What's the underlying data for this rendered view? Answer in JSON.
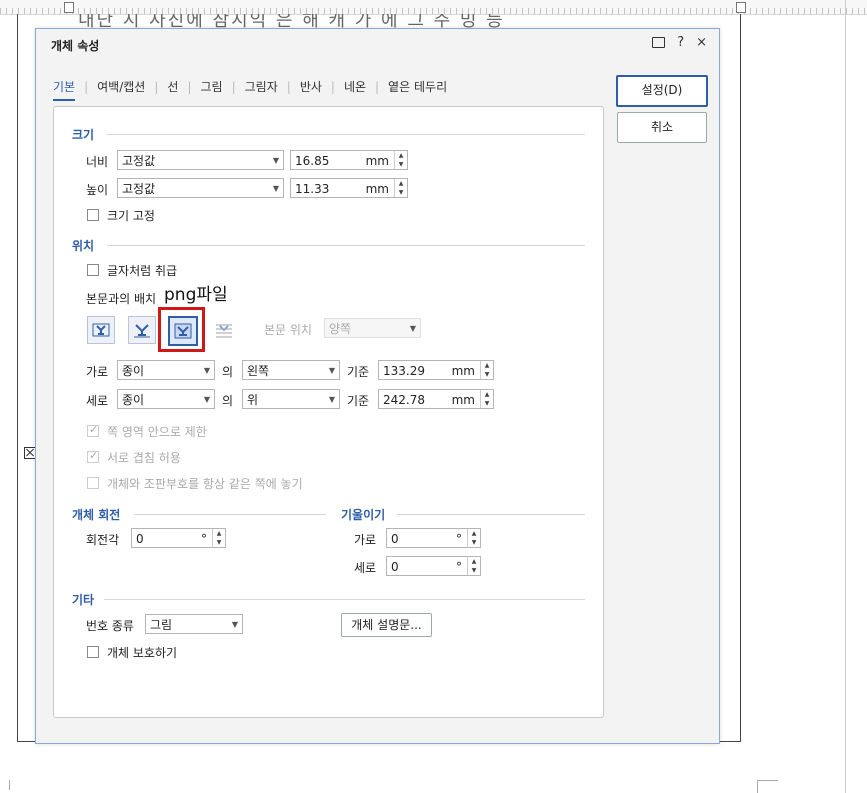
{
  "background": {
    "partial_text": "내단 시 사진에 참시익 은 해 캐 가 에 그 주 밍 등"
  },
  "dialog": {
    "title": "개체 속성",
    "title_icons": [
      "comment-icon",
      "help-icon",
      "close-icon"
    ],
    "help_glyph": "?",
    "close_glyph": "×",
    "tabs": [
      "기본",
      "여백/캡션",
      "선",
      "그림",
      "그림자",
      "반사",
      "네온",
      "옅은 테두리"
    ],
    "buttons": {
      "ok": "설정(D)",
      "cancel": "취소"
    },
    "size": {
      "title": "크기",
      "width_label": "너비",
      "width_mode": "고정값",
      "width_value": "16.85",
      "width_unit": "mm",
      "height_label": "높이",
      "height_mode": "고정값",
      "height_value": "11.33",
      "height_unit": "mm",
      "lock_label": "크기 고정"
    },
    "position": {
      "title": "위치",
      "treat_as_char": "글자처럼 취급",
      "wrap_label": "본문과의 배치",
      "body_pos_label": "본문 위치",
      "body_pos_value": "양쪽",
      "horiz_label": "가로",
      "horiz_ref": "종이",
      "of1": "의",
      "horiz_align": "왼쪽",
      "base1": "기준",
      "horiz_value": "133.29",
      "horiz_unit": "mm",
      "vert_label": "세로",
      "vert_ref": "종이",
      "of2": "의",
      "vert_align": "위",
      "base2": "기준",
      "vert_value": "242.78",
      "vert_unit": "mm",
      "limit_page": "쪽 영역 안으로 제한",
      "allow_overlap": "서로 겹침 허용",
      "same_page": "개체와 조판부호를 항상 같은 쪽에 놓기"
    },
    "rotation": {
      "title": "개체 회전",
      "angle_label": "회전각",
      "angle_value": "0",
      "angle_unit": "°"
    },
    "skew": {
      "title": "기울이기",
      "h_label": "가로",
      "h_value": "0",
      "v_label": "세로",
      "v_value": "0",
      "unit": "°"
    },
    "etc": {
      "title": "기타",
      "number_type_label": "번호 종류",
      "number_type_value": "그림",
      "desc_button": "개체 설명문...",
      "protect_label": "개체 보호하기"
    }
  },
  "annotation": {
    "text": "png파일",
    "color": "#d01818"
  }
}
